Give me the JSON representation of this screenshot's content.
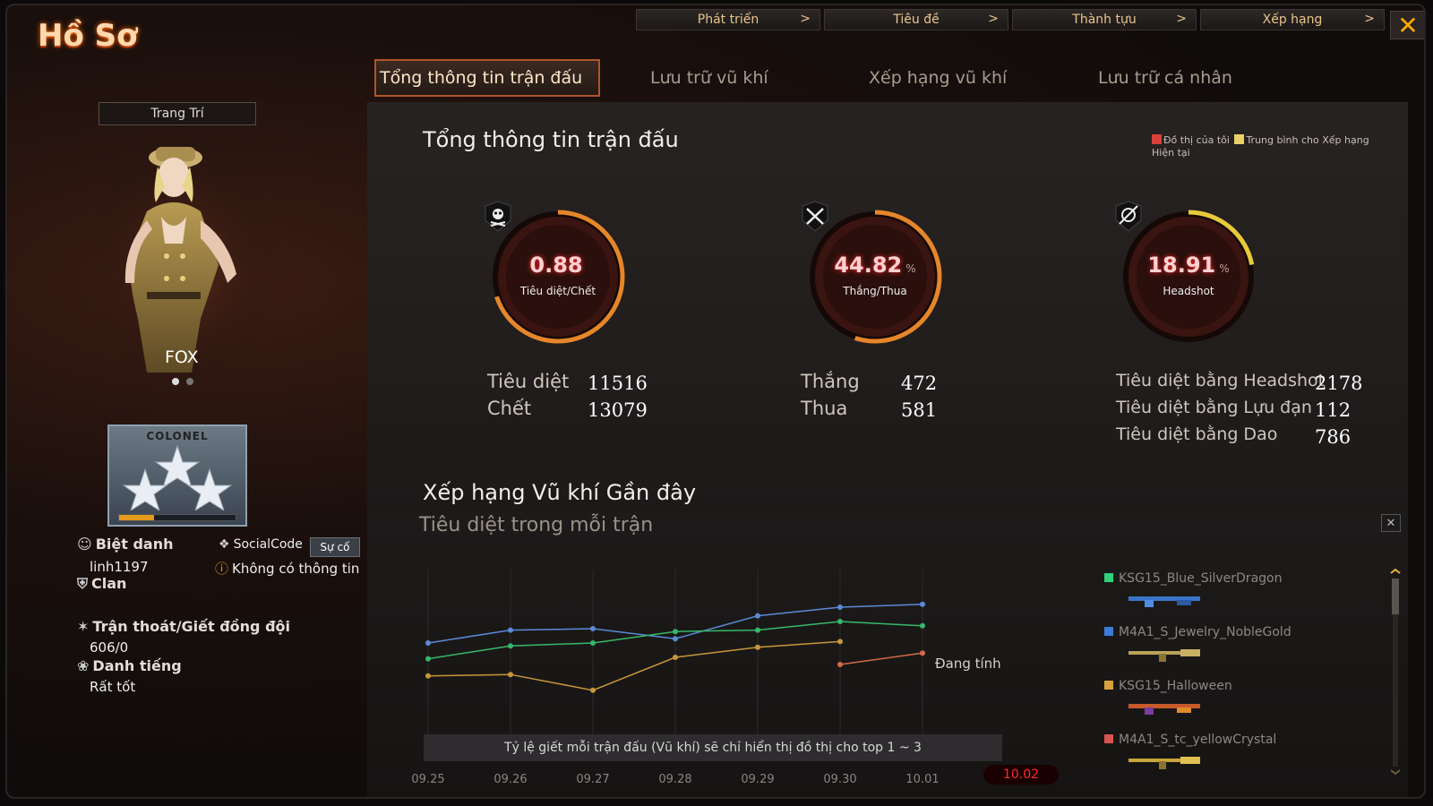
{
  "title": "Hồ Sơ",
  "top_nav": [
    {
      "label": "Phát triển",
      "chevron": ">"
    },
    {
      "label": "Tiêu đề",
      "chevron": ">"
    },
    {
      "label": "Thành tựu",
      "chevron": ">"
    },
    {
      "label": "Xếp hạng",
      "chevron": ">"
    }
  ],
  "close_label": "✕",
  "tabs": [
    {
      "label": "Tổng thông tin trận đấu",
      "active": true
    },
    {
      "label": "Lưu trữ vũ khí"
    },
    {
      "label": "Xếp hạng vũ khí"
    },
    {
      "label": "Lưu trữ cá nhân"
    }
  ],
  "sidebar": {
    "decorate_button": "Trang Trí",
    "character_name": "FOX",
    "rank_title": "COLONEL",
    "rank_progress": 0.3,
    "nickname_label": "Biệt danh",
    "nickname_value": "linh1197",
    "socialcode_label": "SocialCode",
    "socialcode_badge": "Sự cố",
    "socialcode_value": "Không có thông tin",
    "clan_label": "Clan",
    "escape_label": "Trận thoát/Giết đồng đội",
    "escape_value": "606/0",
    "reputation_label": "Danh tiếng",
    "reputation_value": "Rất tốt"
  },
  "summary": {
    "title": "Tổng thông tin trận đấu",
    "legend_mine": "Đồ thị của tôi",
    "legend_avg": "Trung bình cho Xếp hạng Hiện tại",
    "gauges": [
      {
        "value": "0.88",
        "unit": "",
        "caption": "Tiêu diệt/Chết",
        "icon": "skull-icon",
        "fill": 0.7,
        "color": "#e6862a"
      },
      {
        "value": "44.82",
        "unit": "%",
        "caption": "Thắng/Thua",
        "icon": "crossed-swords-icon",
        "fill": 0.55,
        "color": "#e6862a"
      },
      {
        "value": "18.91",
        "unit": "%",
        "caption": "Headshot",
        "icon": "headshot-icon",
        "fill": 0.22,
        "color": "#e8c93a"
      }
    ],
    "stats": [
      [
        {
          "label": "Tiêu diệt",
          "value": "11516"
        },
        {
          "label": "Chết",
          "value": "13079"
        }
      ],
      [
        {
          "label": "Thắng",
          "value": "472"
        },
        {
          "label": "Thua",
          "value": "581"
        }
      ],
      [
        {
          "label": "Tiêu diệt bằng Headshot",
          "value": "2178"
        },
        {
          "label": "Tiêu diệt bằng Lựu đạn",
          "value": "112"
        },
        {
          "label": "Tiêu diệt bằng Dao",
          "value": "786"
        }
      ]
    ]
  },
  "weapons_section": {
    "title": "Xếp hạng Vũ khí Gần đây",
    "subtitle": "Tiêu diệt trong mỗi trận",
    "note": "Tỷ lệ giết mỗi trận đấu (Vũ khí) sẽ chỉ hiển thị đồ thị cho top 1 ~ 3",
    "pending": "Đang tính",
    "close": "✕",
    "current_date": "10.02",
    "weapons": [
      {
        "name": "KSG15_Blue_SilverDragon",
        "color": "#2fd27a"
      },
      {
        "name": "M4A1_S_Jewelry_NobleGold",
        "color": "#3b7bd9"
      },
      {
        "name": "KSG15_Halloween",
        "color": "#d6a33a"
      },
      {
        "name": "M4A1_S_tc_yellowCrystal",
        "color": "#d9534f"
      }
    ]
  },
  "chart_data": {
    "type": "line",
    "x": [
      "09.25",
      "09.26",
      "09.27",
      "09.28",
      "09.29",
      "09.30",
      "10.01"
    ],
    "series": [
      {
        "color": "#5a8ad6",
        "values": [
          0.55,
          0.64,
          0.65,
          0.58,
          0.74,
          0.8,
          0.82
        ]
      },
      {
        "color": "#36b868",
        "values": [
          0.44,
          0.53,
          0.55,
          0.63,
          0.64,
          0.7,
          0.67
        ]
      },
      {
        "color": "#c8963a",
        "values": [
          0.32,
          0.33,
          0.22,
          0.45,
          0.52,
          0.56,
          null
        ]
      },
      {
        "color": "#d56a4a",
        "values": [
          null,
          null,
          null,
          null,
          null,
          0.4,
          0.48
        ]
      }
    ]
  },
  "colors": {
    "accent": "#b0542d",
    "highlight": "#ff2a2a"
  }
}
